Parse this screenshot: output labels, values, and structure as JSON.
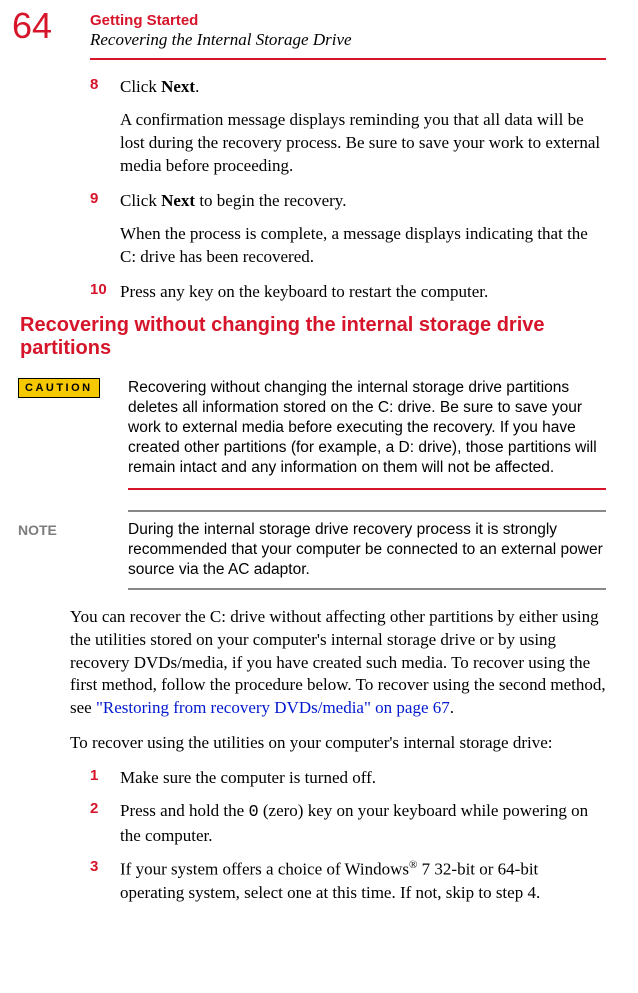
{
  "header": {
    "page_number": "64",
    "section": "Getting Started",
    "subsection": "Recovering the Internal Storage Drive"
  },
  "steps_top": [
    {
      "num": "8",
      "text_prefix": "Click ",
      "bold": "Next",
      "text_suffix": ".",
      "sub": "A confirmation message displays reminding you that all data will be lost during the recovery process. Be sure to save your work to external media before proceeding."
    },
    {
      "num": "9",
      "text_prefix": "Click ",
      "bold": "Next",
      "text_suffix": " to begin the recovery.",
      "sub": "When the process is complete, a message displays indicating that the C: drive has been recovered."
    },
    {
      "num": "10",
      "text_prefix": "Press any key on the keyboard to restart the computer.",
      "bold": "",
      "text_suffix": "",
      "sub": ""
    }
  ],
  "heading2": "Recovering without changing the internal storage drive partitions",
  "caution": {
    "label": "CAUTION",
    "text": "Recovering without changing the internal storage drive partitions deletes all information stored on the C: drive. Be sure to save your work to external media before executing the recovery. If you have created other partitions (for example, a D: drive), those partitions will remain intact and any information on them will not be affected."
  },
  "note": {
    "label": "NOTE",
    "text": "During the internal storage drive recovery process it is strongly recommended that your computer be connected to an external power source via the AC adaptor."
  },
  "para1_prefix": "You can recover the C: drive without affecting other partitions by either using the utilities stored on your computer's internal storage drive or by using recovery DVDs/media, if you have created such media. To recover using the first method, follow the procedure below. To recover using the second method, see ",
  "para1_link": "\"Restoring from recovery DVDs/media\" on page 67",
  "para1_suffix": ".",
  "para2": "To recover using the utilities on your computer's internal storage drive:",
  "steps_bottom": [
    {
      "num": "1",
      "text": "Make sure the computer is turned off."
    },
    {
      "num": "2",
      "text_prefix": "Press and hold the ",
      "mono": "0",
      "text_suffix": " (zero) key on your keyboard while powering on the computer."
    },
    {
      "num": "3",
      "text_prefix": "If your system offers a choice of Windows",
      "sup": "®",
      "text_suffix": " 7 32-bit or 64-bit operating system, select one at this time. If not, skip to step 4."
    }
  ]
}
